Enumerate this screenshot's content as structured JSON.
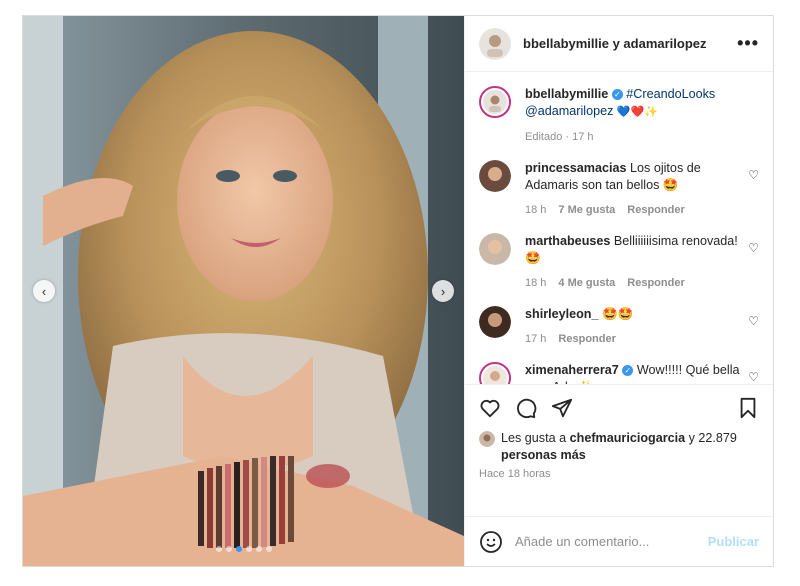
{
  "post": {
    "header_names": "bbellabymillie y adamarilopez",
    "more_label": "•••"
  },
  "caption": {
    "username": "bbellabymillie",
    "hashtag": "#CreandoLooks",
    "mention": "@adamarilopez",
    "emojis": "💙❤️✨",
    "meta": "Editado · 17 h"
  },
  "comments": [
    {
      "username": "princessamacias",
      "text": "Los ojitos de Adamaris son tan bellos 🤩",
      "time": "18 h",
      "likes": "7 Me gusta",
      "reply": "Responder"
    },
    {
      "username": "marthabeuses",
      "text": "Belliiiiiisima renovada! 🤩",
      "time": "18 h",
      "likes": "4 Me gusta",
      "reply": "Responder"
    },
    {
      "username": "shirleyleon_",
      "text": "🤩🤩",
      "time": "17 h",
      "likes": "",
      "reply": "Responder"
    },
    {
      "username": "ximenaherrera7",
      "text": "Wow!!!!! Qué bella eres Ada ✨",
      "time": "",
      "likes": "",
      "reply": ""
    }
  ],
  "likes": {
    "prefix": "Les gusta a ",
    "user": "chefmauriciogarcia",
    "suffix": " y 22.879",
    "others": "personas más"
  },
  "time_ago": "Hace 18 horas",
  "add_comment": {
    "placeholder": "Añade un comentario...",
    "publish_label": "Publicar"
  },
  "carousel": {
    "count": 6,
    "active": 2
  }
}
